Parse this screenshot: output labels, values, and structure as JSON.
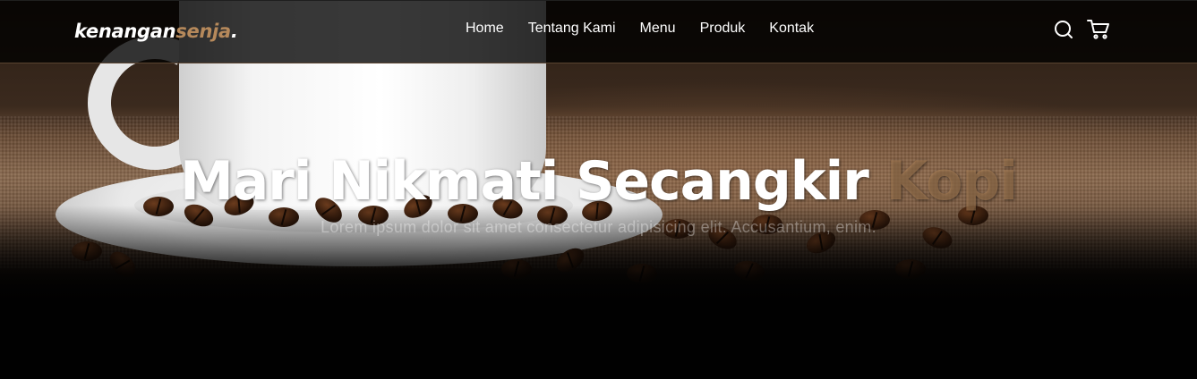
{
  "brand": {
    "name_main": "kenangan",
    "name_accent": "senja",
    "dot": "."
  },
  "nav": {
    "links": [
      "Home",
      "Tentang Kami",
      "Menu",
      "Produk",
      "Kontak"
    ],
    "icons": [
      "search-icon",
      "shopping-cart-icon"
    ]
  },
  "hero": {
    "title_main": "Mari Nikmati Secangkir ",
    "title_accent": "Kopi",
    "subtitle": "Lorem ipsum dolor sit amet consectetur adipisicing elit. Accusantium, enim."
  },
  "colors": {
    "accent": "#b6895b",
    "background": "#010101",
    "text": "#ffffff"
  }
}
